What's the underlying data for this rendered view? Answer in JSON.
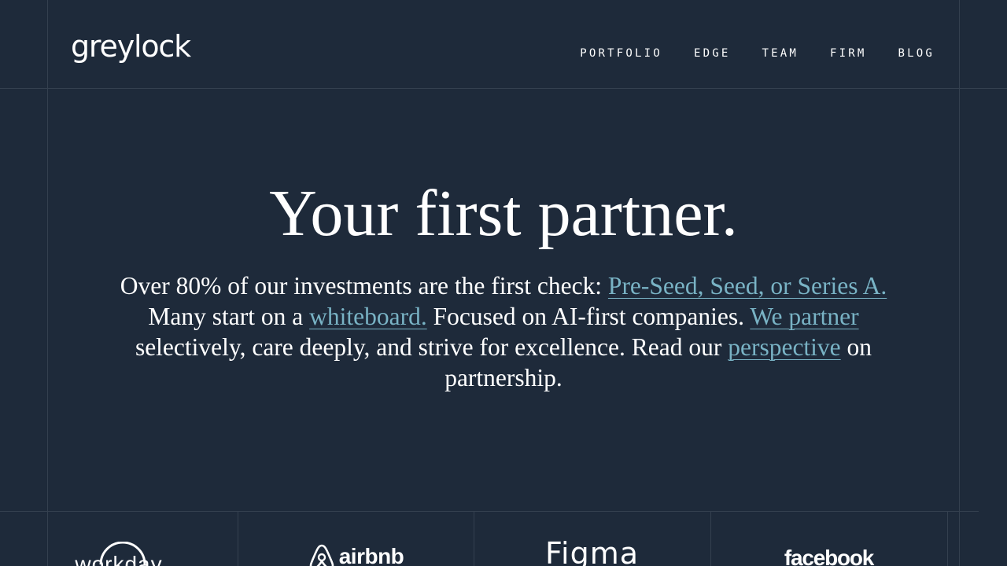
{
  "header": {
    "logo_text": "greylock",
    "nav": [
      {
        "label": "PORTFOLIO"
      },
      {
        "label": "EDGE"
      },
      {
        "label": "TEAM"
      },
      {
        "label": "FIRM"
      },
      {
        "label": "BLOG"
      }
    ]
  },
  "hero": {
    "title": "Your first partner.",
    "body": {
      "part1": "Over 80% of our investments are the first check: ",
      "link1": "Pre-Seed, Seed, or Series A.",
      "part2": " Many start on a ",
      "link2": "whiteboard.",
      "part3": " Focused on AI-first companies. ",
      "link3": "We partner",
      "part4": " selectively, care deeply, and strive for excellence. Read our ",
      "link4": "perspective",
      "part5": " on partnership."
    }
  },
  "portfolio_logos": [
    {
      "name": "workday",
      "icon": "workday-logo"
    },
    {
      "name": "airbnb",
      "icon": "airbnb-logo"
    },
    {
      "name": "Figma",
      "icon": "figma-logo"
    },
    {
      "name": "facebook",
      "icon": "facebook-logo"
    }
  ],
  "colors": {
    "background": "#1e2a3a",
    "grid_line": "#34404f",
    "text": "#ffffff",
    "link": "#79b3c5"
  }
}
